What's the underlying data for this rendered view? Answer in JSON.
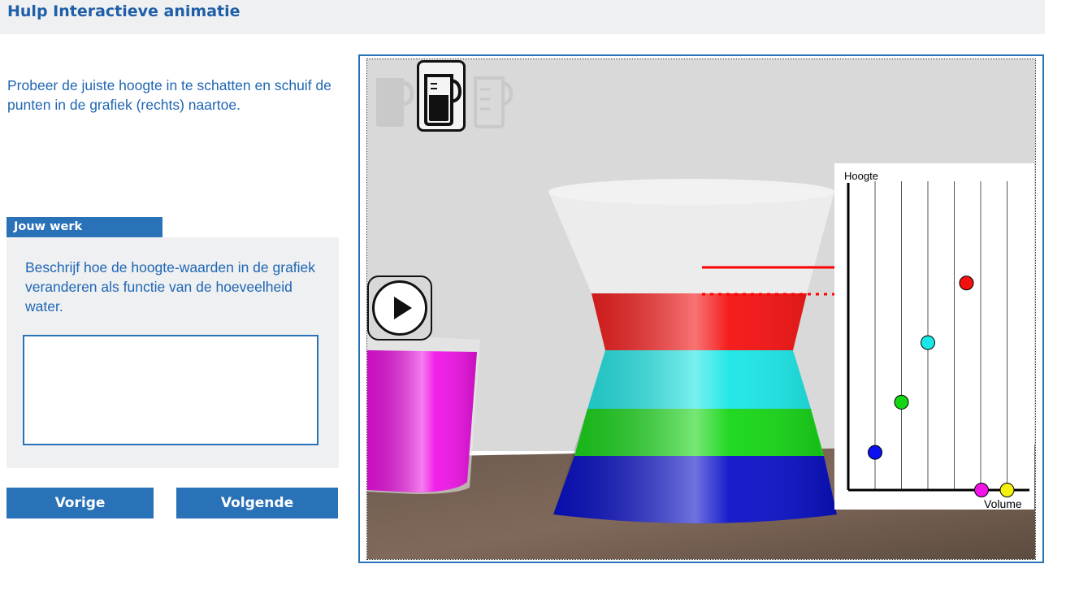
{
  "header": {
    "title": "Hulp Interactieve animatie"
  },
  "intro": {
    "text": "Probeer de juiste hoogte in te schatten en schuif de punten in de grafiek (rechts) naartoe."
  },
  "work": {
    "tab_label": "Jouw werk",
    "description": "Beschrijf hoe de hoogte-waarden in de grafiek veranderen als functie van de hoeveelheid water.",
    "answer_value": ""
  },
  "nav": {
    "prev_label": "Vorige",
    "next_label": "Volgende"
  },
  "toolbar": {
    "tools": [
      "empty-beaker-icon",
      "full-beaker-icon",
      "measuring-beaker-icon"
    ],
    "active": 1
  },
  "vessel_layers": [
    "#0a10c8",
    "#15d615",
    "#19e6e6",
    "#f41010"
  ],
  "glass_liquid_color": "#f012e6",
  "chart_data": {
    "type": "scatter",
    "xlabel": "Volume",
    "ylabel": "Hoogte",
    "gridlines": 6,
    "points": [
      {
        "x": 1,
        "y": 0.12,
        "color": "#0a10f0"
      },
      {
        "x": 2,
        "y": 0.28,
        "color": "#15d615"
      },
      {
        "x": 3,
        "y": 0.47,
        "color": "#19e6e6"
      },
      {
        "x": 4,
        "y": 0.66,
        "color": "#f41010"
      },
      {
        "x": 5,
        "y": 0.0,
        "color": "#f012e6"
      },
      {
        "x": 6,
        "y": 0.0,
        "color": "#f5f010"
      }
    ],
    "target_level": 0.66,
    "top_level": 0.74
  }
}
